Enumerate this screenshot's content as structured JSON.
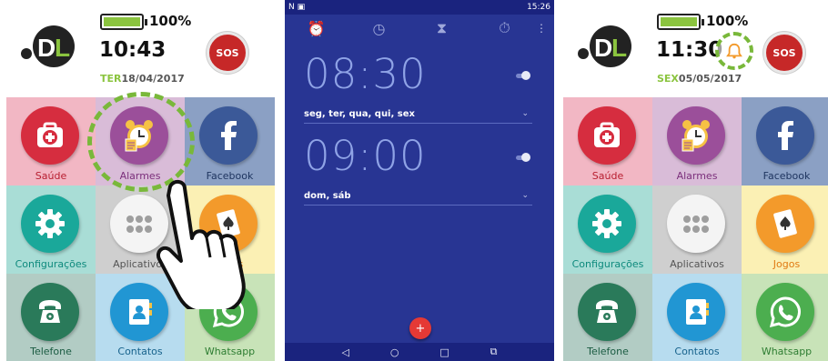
{
  "left": {
    "battery_percent": "100%",
    "time": "10:43",
    "date_dow": "TER",
    "date": "18/04/2017",
    "sos_label": "SOS",
    "tiles": [
      "Saúde",
      "Alarmes",
      "Facebook",
      "Configurações",
      "Aplicativos",
      "Jogos",
      "Telefone",
      "Contatos",
      "Whatsapp"
    ]
  },
  "middle": {
    "status_time": "15:26",
    "alarms": [
      {
        "time": "08:30",
        "days": "seg, ter, qua, qui, sex"
      },
      {
        "time": "09:00",
        "days": "dom, sáb"
      }
    ],
    "fab_label": "+"
  },
  "right": {
    "battery_percent": "100%",
    "time": "11:30",
    "date_dow": "SEX",
    "date": "05/05/2017",
    "sos_label": "SOS",
    "tiles": [
      "Saúde",
      "Alarmes",
      "Facebook",
      "Configurações",
      "Aplicativos",
      "Jogos",
      "Telefone",
      "Contatos",
      "Whatsapp"
    ]
  },
  "colors": {
    "accent_green": "#8bc43f",
    "sos_red": "#c62828",
    "clock_blue": "#283593"
  }
}
